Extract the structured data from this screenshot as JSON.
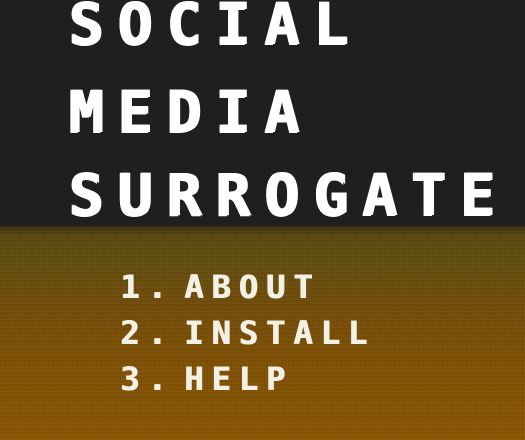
{
  "title": {
    "lines": [
      "SOCIAL",
      "MEDIA",
      "SURROGATE"
    ]
  },
  "menu": {
    "items": [
      {
        "number": "1.",
        "label": "ABOUT"
      },
      {
        "number": "2.",
        "label": "INSTALL"
      },
      {
        "number": "3.",
        "label": "HELP"
      }
    ]
  },
  "colors": {
    "title_panel": "#1f1f1f",
    "title_text": "#ffffff",
    "menu_text": "#f3f0e6",
    "ground_top": "#5a4a12",
    "ground_bottom": "#8a5804"
  }
}
